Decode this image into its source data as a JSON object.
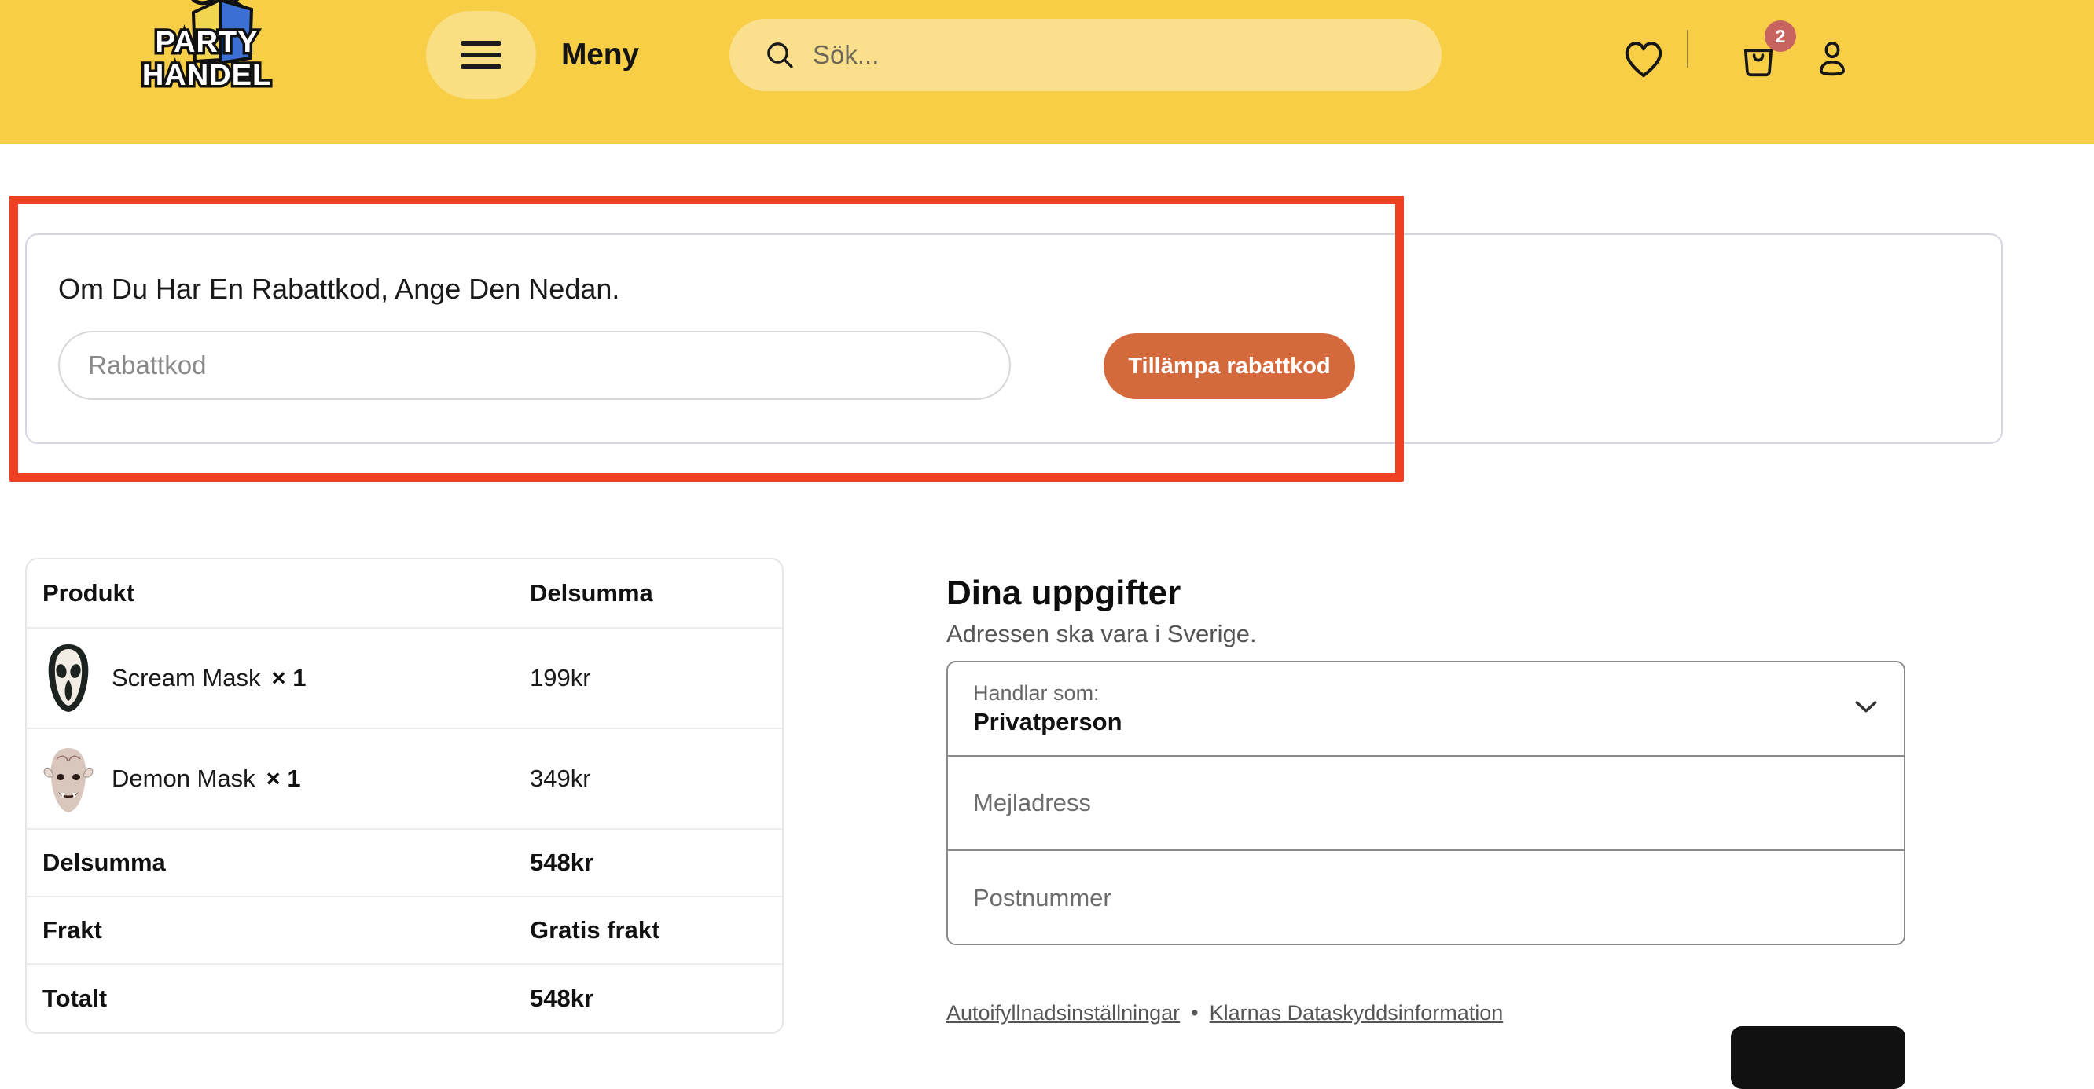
{
  "header": {
    "logo_line1": "PARTY",
    "logo_line2": "HANDEL",
    "menu_label": "Meny",
    "menu_icon": "hamburger-icon",
    "search_placeholder": "Sök...",
    "search_value": "",
    "search_icon": "search-icon",
    "wishlist_icon": "heart-icon",
    "cart_icon": "shopping-bag-icon",
    "cart_badge": "2",
    "account_icon": "user-icon",
    "brand_yellow": "#F7CE46",
    "badge_color": "#C8645F"
  },
  "coupon": {
    "title": "Om Du Har En Rabattkod, Ange Den Nedan.",
    "input_placeholder": "Rabattkod",
    "input_value": "",
    "apply_label": "Tillämpa rabattkod",
    "apply_color": "#D4693C",
    "highlight_color": "#EE4023"
  },
  "order": {
    "columns": [
      "Produkt",
      "Delsumma"
    ],
    "items": [
      {
        "name": "Scream Mask",
        "qty": "× 1",
        "subtotal": "199kr",
        "thumb": "scream-mask-thumb"
      },
      {
        "name": "Demon Mask",
        "qty": "× 1",
        "subtotal": "349kr",
        "thumb": "demon-mask-thumb"
      }
    ],
    "totals": [
      {
        "label": "Delsumma",
        "value": "548kr"
      },
      {
        "label": "Frakt",
        "value": "Gratis frakt"
      },
      {
        "label": "Totalt",
        "value": "548kr"
      }
    ]
  },
  "details": {
    "title": "Dina uppgifter",
    "subtitle": "Adressen ska vara i Sverige.",
    "customer_type_label": "Handlar som:",
    "customer_type_value": "Privatperson",
    "customer_type_icon": "chevron-down-icon",
    "email_placeholder": "Mejladress",
    "email_value": "",
    "postal_placeholder": "Postnummer",
    "postal_value": "",
    "links": {
      "autofill": "Autoifyllnadsinställningar",
      "separator": "•",
      "privacy": "Klarnas Dataskyddsinformation"
    }
  }
}
